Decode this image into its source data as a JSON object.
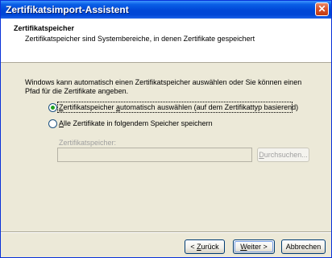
{
  "window": {
    "title": "Zertifikatsimport-Assistent",
    "close_glyph": "✕"
  },
  "header": {
    "title": "Zertifikatspeicher",
    "description": "Zertifikatspeicher sind Systembereiche, in denen Zertifikate gespeichert"
  },
  "body": {
    "intro": "Windows kann automatisch einen Zertifikatspeicher auswählen oder Sie können einen Pfad für die Zertifikate angeben.",
    "options": [
      {
        "pre": "",
        "key": "Z",
        "post": "ertifikatspeicher ",
        "key2": "a",
        "post2": "utomatisch auswählen (auf dem Zertifikattyp basierend)",
        "selected": true
      },
      {
        "pre": "",
        "key": "A",
        "post": "lle Zertifikate in folgendem Speicher speichern",
        "selected": false
      }
    ],
    "store_label": "Zertifikatspeicher:",
    "store_value": "",
    "browse": {
      "key": "D",
      "rest": "urchsuchen..."
    }
  },
  "footer": {
    "back": {
      "pre": "< ",
      "key": "Z",
      "rest": "urück"
    },
    "next": {
      "key": "W",
      "rest": "eiter >"
    },
    "cancel": "Abbrechen"
  },
  "colors": {
    "titlebar": "#0046d6",
    "radio_selected": "#21a121",
    "dialog_bg": "#ece9d8"
  }
}
